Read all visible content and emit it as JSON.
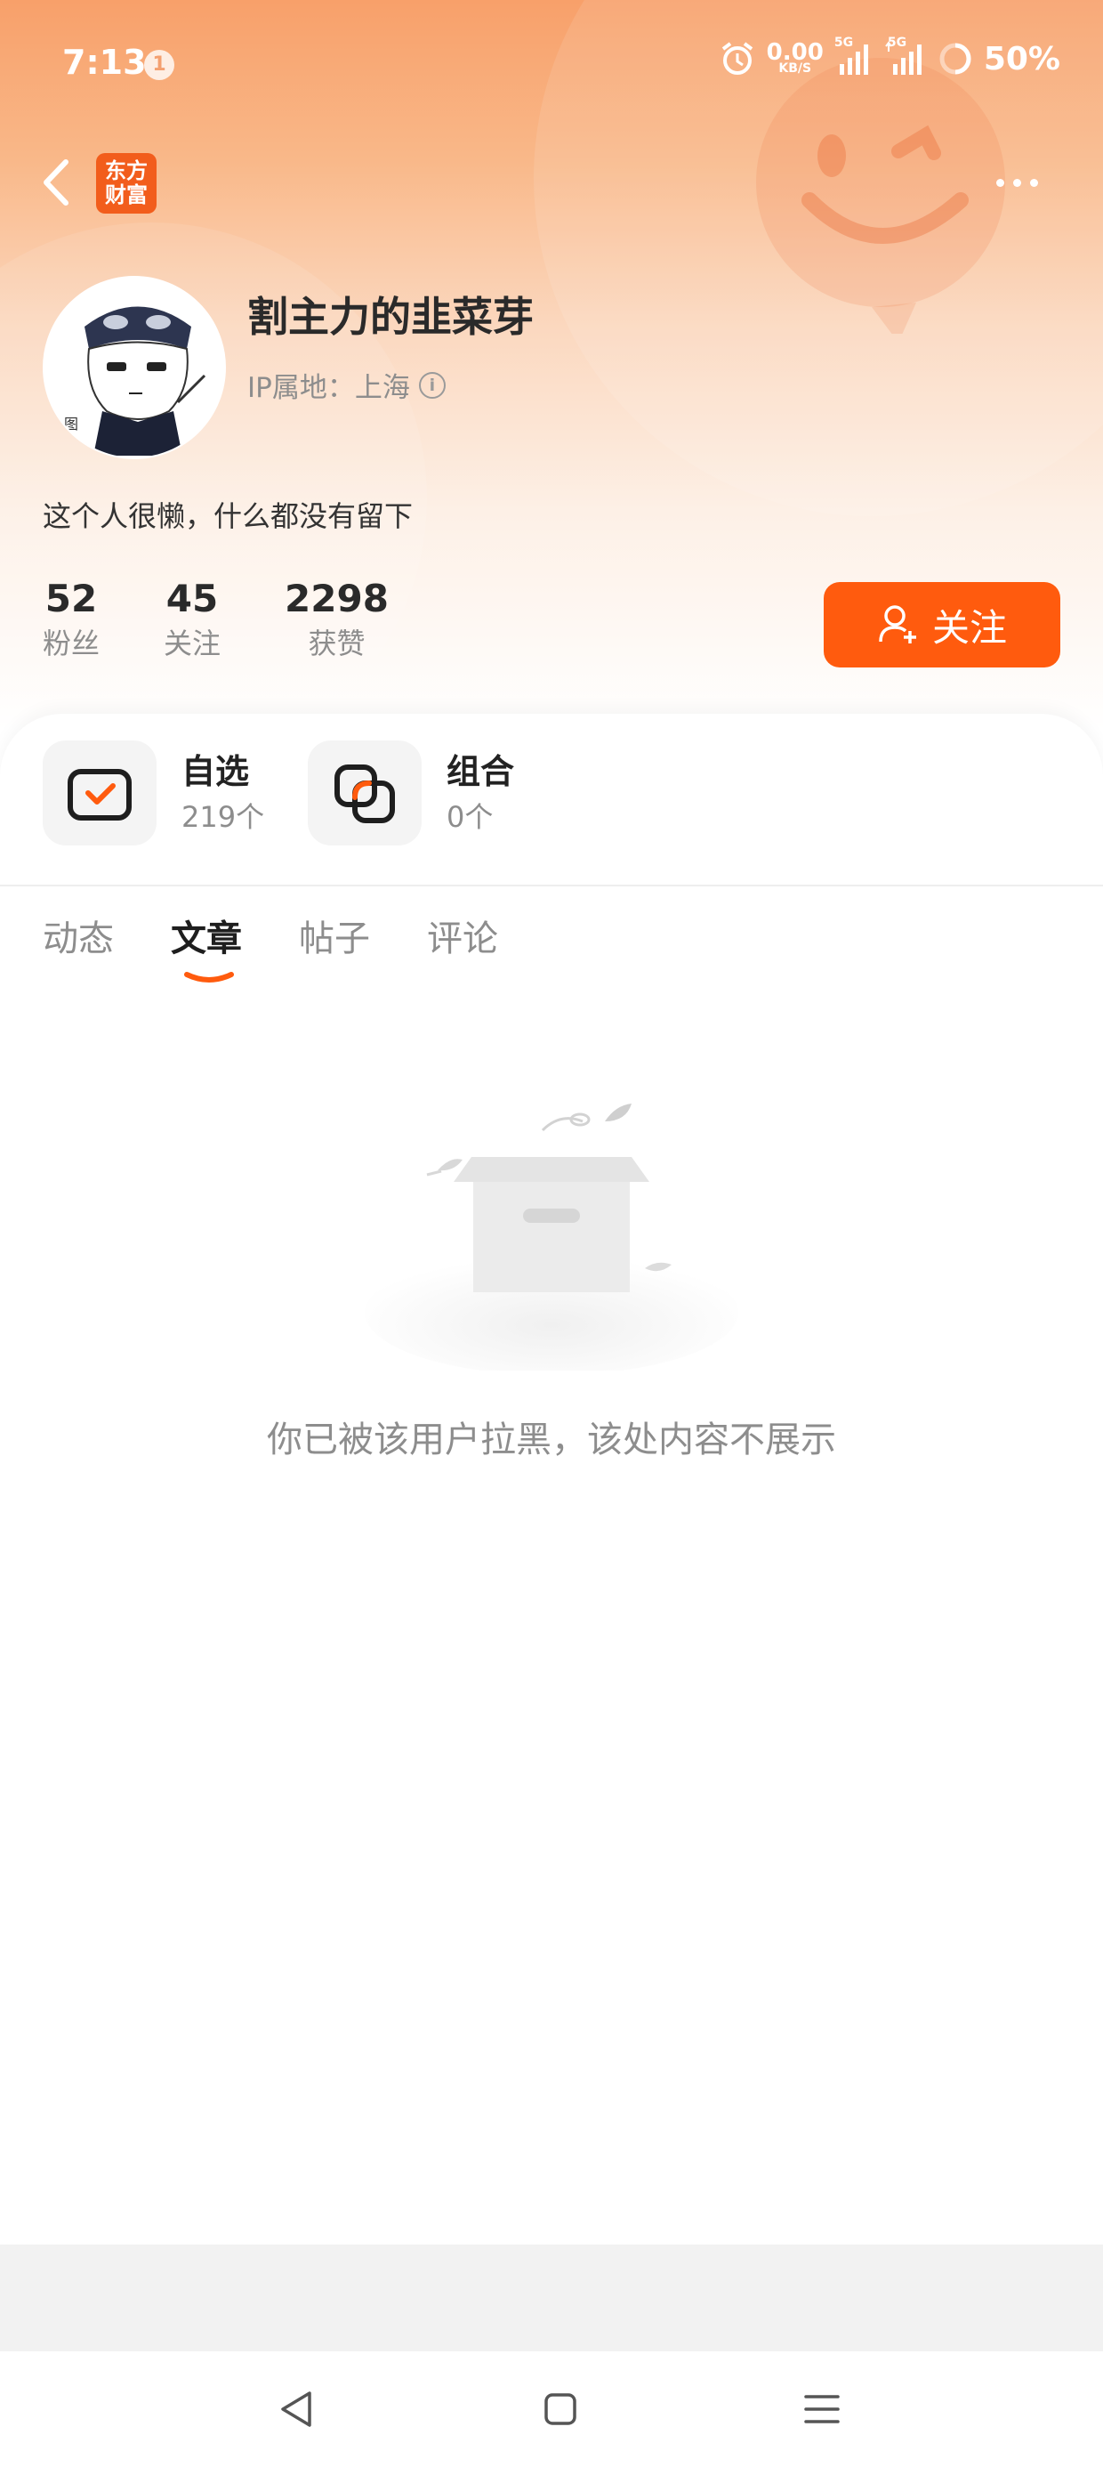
{
  "status_bar": {
    "time": "7:13",
    "notification_count": "1",
    "net_speed": "0.00",
    "net_unit": "KB/S",
    "signal1": "5G",
    "signal2": "5G",
    "battery": "50%"
  },
  "brand_logo": {
    "line1": "东方",
    "line2": "财富",
    "color": "#f25d1c"
  },
  "profile": {
    "username": "割主力的韭菜芽",
    "ip_location": "IP属地：上海",
    "bio": "这个人很懒，什么都没有留下",
    "stats": [
      {
        "value": "52",
        "label": "粉丝"
      },
      {
        "value": "45",
        "label": "关注"
      },
      {
        "value": "2298",
        "label": "获赞"
      }
    ],
    "follow_label": "关注",
    "accent_color": "#ff5b0e"
  },
  "features": [
    {
      "title": "自选",
      "count": "219个",
      "icon": "checkbox-icon"
    },
    {
      "title": "组合",
      "count": "0个",
      "icon": "overlap-squares-icon"
    }
  ],
  "tabs": [
    {
      "label": "动态",
      "active": false
    },
    {
      "label": "文章",
      "active": true
    },
    {
      "label": "帖子",
      "active": false
    },
    {
      "label": "评论",
      "active": false
    }
  ],
  "empty_state": {
    "icon": "empty-box-icon",
    "message": "你已被该用户拉黑，该处内容不展示"
  },
  "system_nav": [
    "back-icon",
    "home-icon",
    "menu-icon"
  ]
}
